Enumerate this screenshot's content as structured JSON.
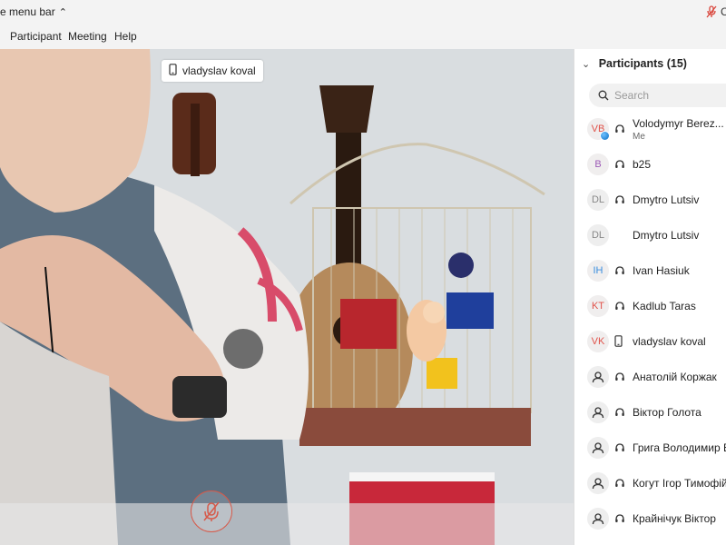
{
  "topbar": {
    "hide_menu_label": "e menu bar",
    "right_letter": "C"
  },
  "menubar": {
    "items": [
      {
        "label": "Participant"
      },
      {
        "label": "Meeting"
      },
      {
        "label": "Help"
      }
    ]
  },
  "video": {
    "name_tag": "vladyslav koval"
  },
  "participants": {
    "header": "Participants (15)",
    "search_placeholder": "Search",
    "list": [
      {
        "initials": "VB",
        "name": "Volodymyr Berez...",
        "sub": "Me",
        "icon": "headset",
        "color": "#e0524a"
      },
      {
        "initials": "B",
        "name": "b25",
        "icon": "headset",
        "color": "#9b59b6"
      },
      {
        "initials": "DL",
        "name": "Dmytro Lutsiv",
        "icon": "headset",
        "color": "#888888"
      },
      {
        "initials": "DL",
        "name": "Dmytro Lutsiv",
        "icon": "",
        "color": "#888888"
      },
      {
        "initials": "IH",
        "name": "Ivan Hasiuk",
        "icon": "headset",
        "color": "#3a8dde"
      },
      {
        "initials": "KT",
        "name": "Kadlub Taras",
        "icon": "headset",
        "color": "#e0524a"
      },
      {
        "initials": "VK",
        "name": "vladyslav koval",
        "icon": "phone",
        "color": "#e0524a"
      },
      {
        "initials": "",
        "name": "Анатолій Коржак",
        "icon": "headset",
        "color": "#555555"
      },
      {
        "initials": "",
        "name": "Віктор Голота",
        "icon": "headset",
        "color": "#555555"
      },
      {
        "initials": "",
        "name": "Грига Володимир В",
        "icon": "headset",
        "color": "#555555"
      },
      {
        "initials": "",
        "name": "Когут Ігор Тимофій",
        "icon": "headset",
        "color": "#555555"
      },
      {
        "initials": "",
        "name": "Крайнічук Віктор",
        "icon": "headset",
        "color": "#555555"
      }
    ]
  }
}
